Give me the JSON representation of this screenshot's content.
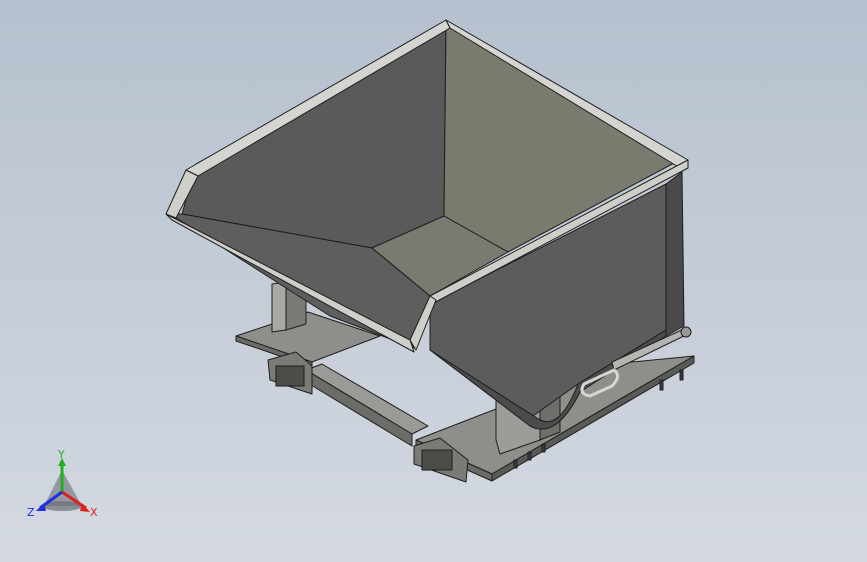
{
  "view": {
    "background_top": "#b6c0ce",
    "background_bottom": "#d4d9e1"
  },
  "triad": {
    "x_label": "X",
    "y_label": "Y",
    "z_label": "Z",
    "x_color": "#e02020",
    "y_color": "#20b020",
    "z_color": "#2030e0"
  },
  "model": {
    "body_color": "#5e5e5e",
    "inner_color": "#7a7a6e",
    "rim_color": "#c9c9c4",
    "frame_color": "#8c8c88",
    "edge_color": "#1e1e1e"
  }
}
